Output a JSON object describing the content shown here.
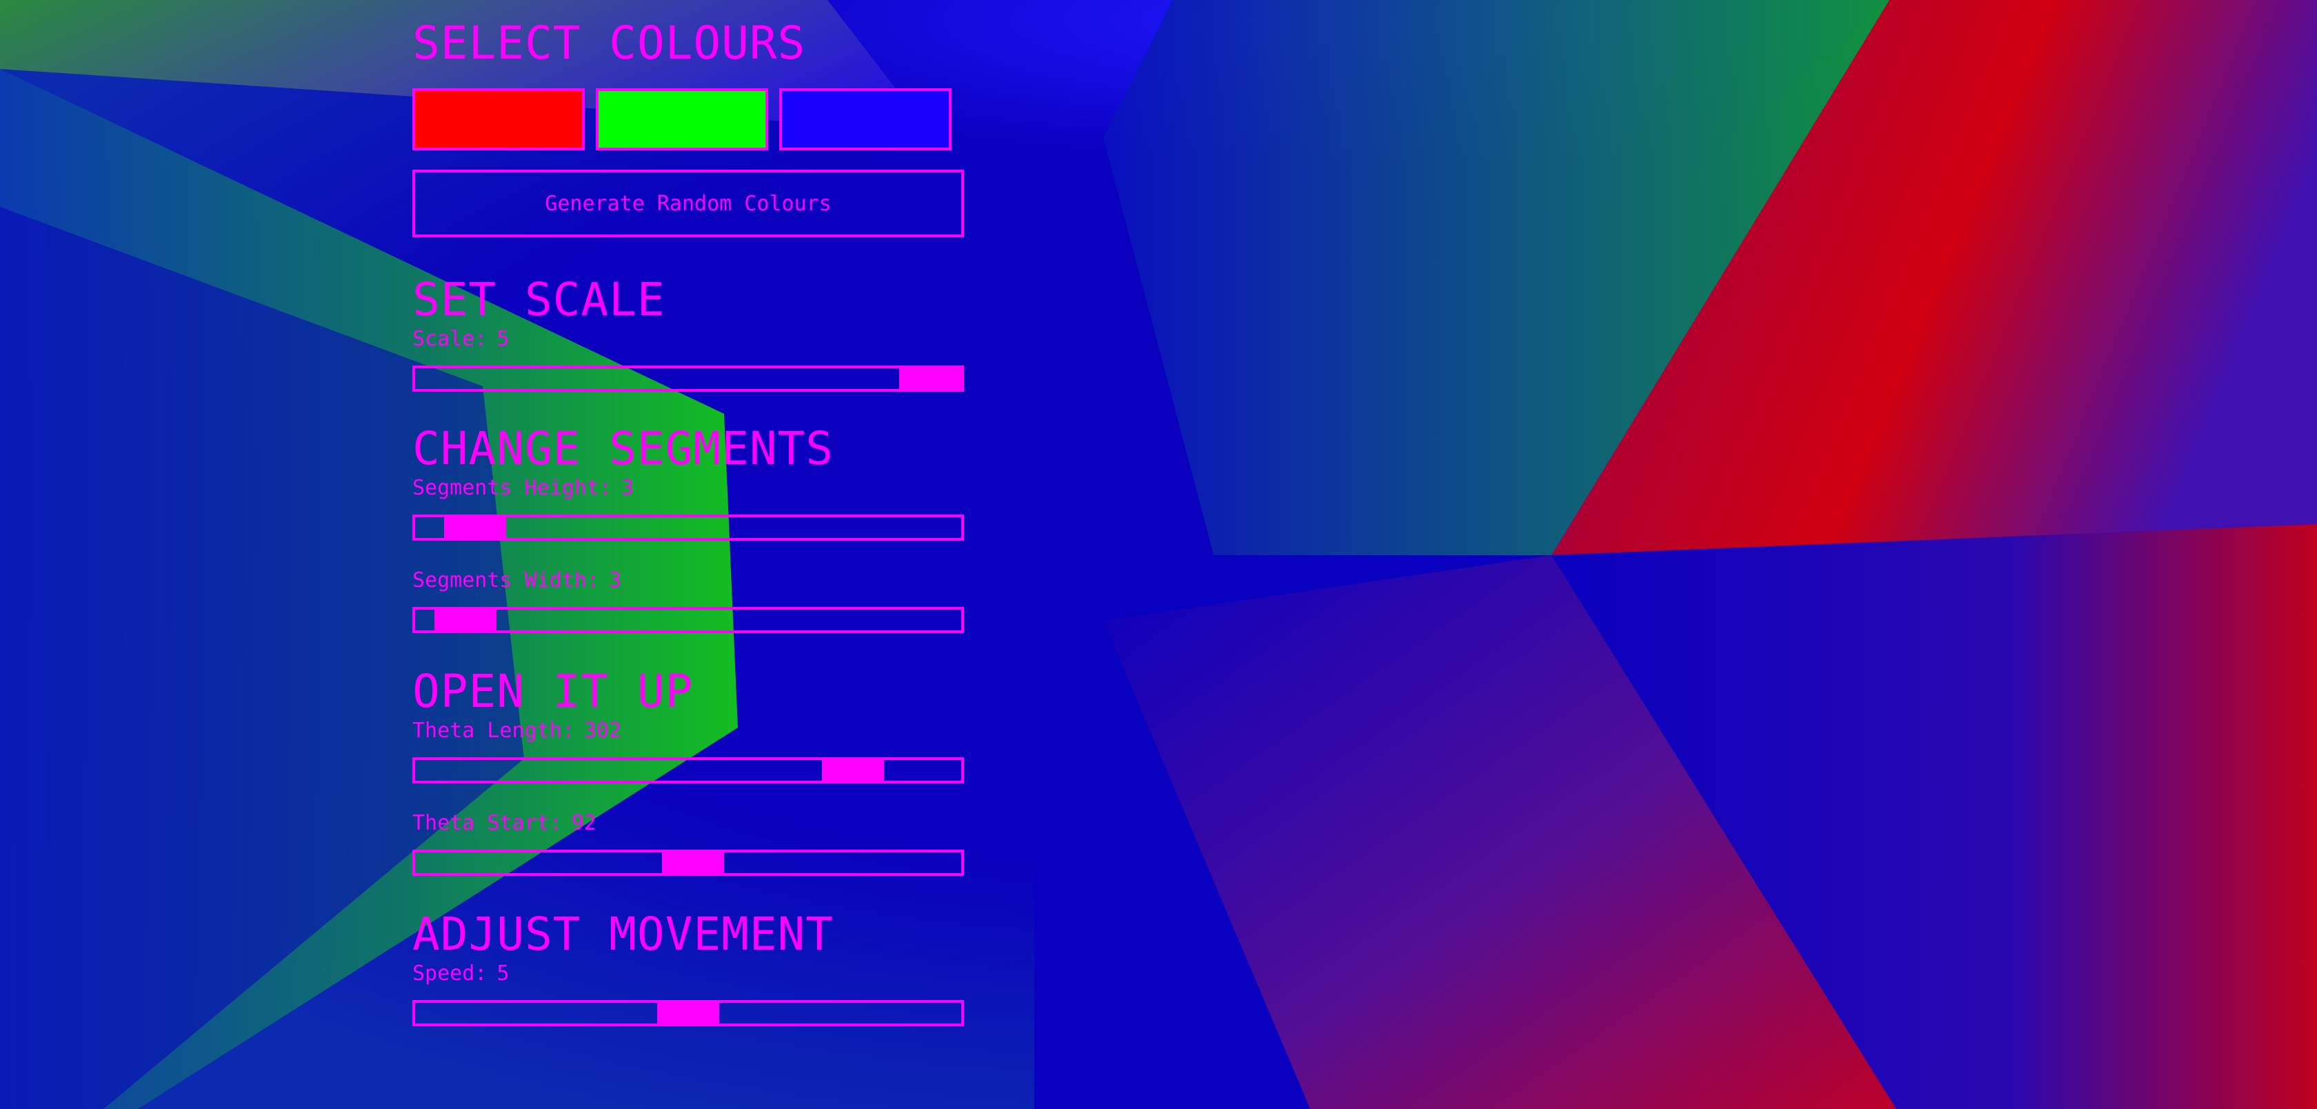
{
  "colors": {
    "accent": "#ff00ff",
    "background_blue": "#0900bd",
    "bright_blue": "#1a10ff",
    "green": "#12c21a",
    "red": "#e00010"
  },
  "sections": {
    "colours": {
      "title": "SELECT COLOURS",
      "swatches": [
        "#ff0000",
        "#00ff00",
        "#1a00ff"
      ],
      "random_button": "Generate Random Colours"
    },
    "scale": {
      "title": "SET SCALE",
      "label": "Scale:",
      "value": "5",
      "fraction": 1.0
    },
    "segments": {
      "title": "CHANGE SEGMENTS",
      "height_label": "Segments Height:",
      "height_value": "3",
      "height_fraction": 0.06,
      "width_label": "Segments Width:",
      "width_value": "3",
      "width_fraction": 0.04
    },
    "open": {
      "title": "OPEN IT UP",
      "theta_length_label": "Theta Length:",
      "theta_length_value": "302",
      "theta_length_fraction": 0.84,
      "theta_start_label": "Theta Start:",
      "theta_start_value": "92",
      "theta_start_fraction": 0.51
    },
    "movement": {
      "title": "ADJUST MOVEMENT",
      "speed_label": "Speed:",
      "speed_value": "5",
      "speed_fraction": 0.5
    }
  }
}
